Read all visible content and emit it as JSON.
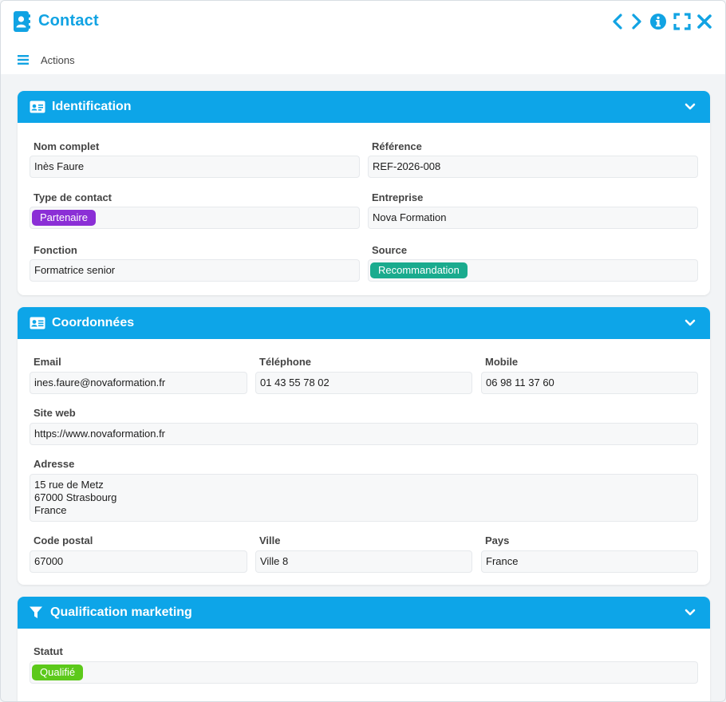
{
  "window": {
    "title": "Contact"
  },
  "toolbar": {
    "actions_label": "Actions"
  },
  "identification": {
    "title": "Identification",
    "nom_complet": {
      "label": "Nom complet",
      "value": "Inès Faure"
    },
    "reference": {
      "label": "Référence",
      "value": "REF-2026-008"
    },
    "type_contact": {
      "label": "Type de contact",
      "value": "Partenaire",
      "color": "#8b2fd6"
    },
    "entreprise": {
      "label": "Entreprise",
      "value": "Nova Formation"
    },
    "fonction": {
      "label": "Fonction",
      "value": "Formatrice senior"
    },
    "source": {
      "label": "Source",
      "value": "Recommandation",
      "color": "#1aab8e"
    }
  },
  "coordonnees": {
    "title": "Coordonnées",
    "email": {
      "label": "Email",
      "value": "ines.faure@novaformation.fr"
    },
    "telephone": {
      "label": "Téléphone",
      "value": "01 43 55 78 02"
    },
    "mobile": {
      "label": "Mobile",
      "value": "06 98 11 37 60"
    },
    "site_web": {
      "label": "Site web",
      "value": "https://www.novaformation.fr"
    },
    "adresse": {
      "label": "Adresse",
      "lines": [
        "15 rue de Metz",
        "67000 Strasbourg",
        "France"
      ]
    },
    "code_postal": {
      "label": "Code postal",
      "value": "67000"
    },
    "ville": {
      "label": "Ville",
      "value": "Ville 8"
    },
    "pays": {
      "label": "Pays",
      "value": "France"
    }
  },
  "qualification": {
    "title": "Qualification marketing",
    "statut": {
      "label": "Statut",
      "value": "Qualifié",
      "color": "#5cc91a"
    }
  },
  "colors": {
    "accent": "#0da5e8",
    "title": "#11a3e3"
  },
  "icons": {
    "title": "address-book-icon",
    "prev": "chevron-left-icon",
    "next": "chevron-right-icon",
    "info": "info-icon",
    "fullscreen": "fullscreen-icon",
    "close": "close-icon",
    "menu": "hamburger-icon",
    "identification": "id-card-icon",
    "coordonnees": "address-card-icon",
    "qualification": "filter-icon",
    "collapse": "chevron-down-icon"
  }
}
